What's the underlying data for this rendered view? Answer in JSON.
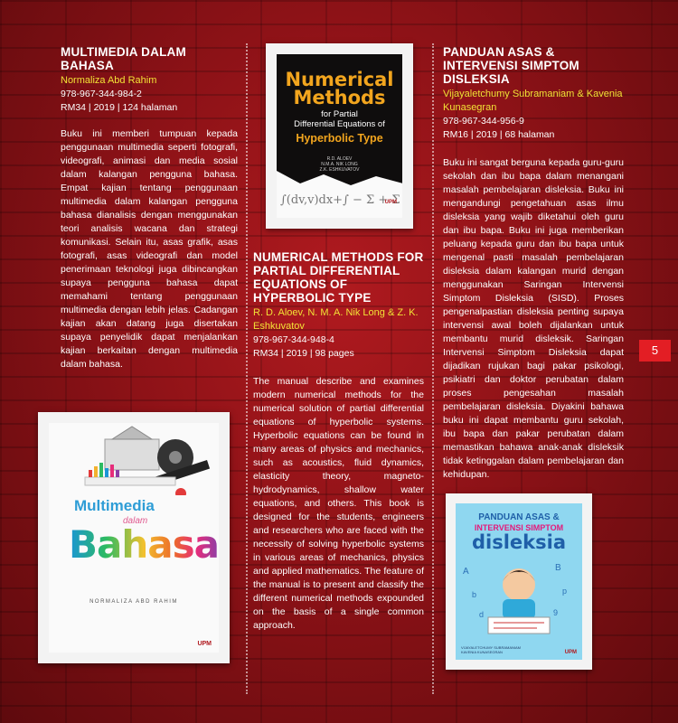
{
  "page_number": "5",
  "books": [
    {
      "title": "MULTIMEDIA DALAM BAHASA",
      "authors": "Normaliza Abd Rahim",
      "isbn": "978-967-344-984-2",
      "details": "RM34 | 2019 | 124 halaman",
      "description": "Buku ini memberi tumpuan kepada penggunaan multimedia seperti fotografi, videografi, animasi dan media sosial dalam kalangan pengguna bahasa. Empat kajian tentang penggunaan multimedia dalam kalangan pengguna bahasa dianalisis dengan menggunakan teori analisis wacana dan strategi komunikasi. Selain itu, asas grafik, asas fotografi, asas videografi dan model penerimaan teknologi juga dibincangkan supaya pengguna bahasa dapat memahami tentang penggunaan multimedia dengan lebih jelas. Cadangan kajian akan datang juga disertakan supaya penyelidik dapat menjalankan kajian berkaitan dengan multimedia dalam bahasa.",
      "cover": {
        "line1": "Multimedia",
        "line2": "dalam",
        "line3": "Bahasa",
        "author": "NORMALIZA ABD RAHIM",
        "publisher": "UPM"
      }
    },
    {
      "title": "NUMERICAL METHODS FOR PARTIAL DIFFERENTIAL EQUATIONS OF HYPERBOLIC TYPE",
      "authors": "R. D. Aloev, N. M. A. Nik Long & Z. K. Eshkuvatov",
      "isbn": "978-967-344-948-4",
      "details": "RM34 | 2019 | 98 pages",
      "description": "The manual describe and examines modern numerical methods for the numerical solution of partial differential equations of hyperbolic systems. Hyperbolic equations can be found in many areas of physics and mechanics, such as acoustics, fluid dynamics, elasticity theory, magneto-hydrodynamics, shallow water equations, and others. This book is designed for the students, engineers and researchers who are faced with the necessity of solving hyperbolic systems in various areas of mechanics, physics and applied mathematics. The feature of the manual is to present and classify the different numerical methods expounded on the basis of a single common approach.",
      "cover": {
        "line1": "Numerical",
        "line2": "Methods",
        "line3": "for Partial",
        "line4": "Differential Equations of",
        "line5": "Hyperbolic Type",
        "authors": [
          "R.D. ALOEV",
          "N.M.A. NIK LONG",
          "Z.K. ESHKUVATOV"
        ],
        "publisher": "UPM"
      }
    },
    {
      "title": "PANDUAN ASAS & INTERVENSI SIMPTOM DISLEKSIA",
      "authors": "Vijayaletchumy Subramaniam & Kavenia Kunasegran",
      "isbn": "978-967-344-956-9",
      "details": "RM16 | 2019 | 68 halaman",
      "description": "Buku ini sangat berguna kepada guru-guru sekolah dan ibu bapa dalam menangani masalah pembelajaran disleksia. Buku ini mengandungi pengetahuan asas ilmu disleksia yang wajib diketahui oleh guru dan ibu bapa. Buku ini juga memberikan peluang kepada guru dan ibu bapa untuk mengenal pasti masalah pembelajaran disleksia dalam kalangan murid dengan menggunakan Saringan Intervensi Simptom Disleksia (SISD). Proses pengenalpastian disleksia penting supaya intervensi awal boleh dijalankan untuk membantu murid disleksik. Saringan Intervensi Simptom Disleksia dapat dijadikan rujukan bagi pakar psikologi, psikiatri dan doktor perubatan dalam proses pengesahan masalah pembelajaran disleksia. Diyakini bahawa buku ini dapat membantu guru sekolah, ibu bapa dan pakar perubatan dalam memastikan bahawa anak-anak disleksik tidak ketinggalan dalam pembelajaran dan kehidupan.",
      "cover": {
        "line1": "PANDUAN ASAS &",
        "line2": "INTERVENSI SIMPTOM",
        "line3": "disleksia",
        "authors": [
          "VIJAYALETCHUMY SUBRAMANIAM",
          "KAVENIA KUNASEGRAN"
        ],
        "publisher": "UPM"
      }
    }
  ]
}
